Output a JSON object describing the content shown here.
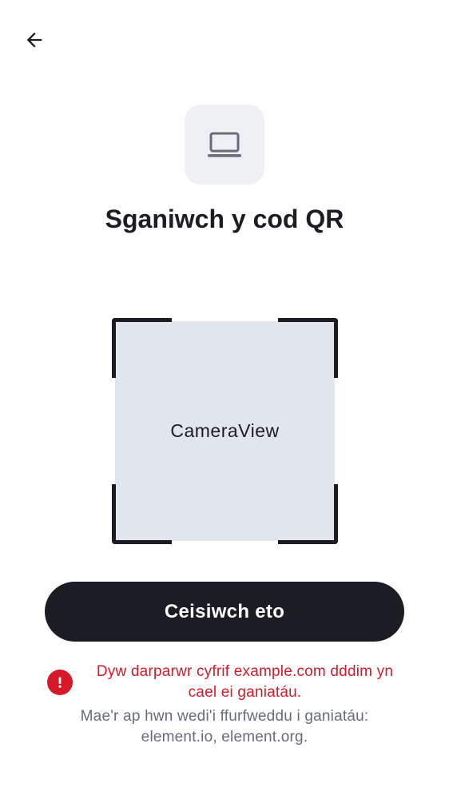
{
  "header": {
    "back_icon": "arrow-left-icon"
  },
  "hero": {
    "icon": "laptop-icon",
    "title": "Sganiwch y cod QR"
  },
  "camera": {
    "placeholder_label": "CameraView"
  },
  "actions": {
    "retry_label": "Ceisiwch eto"
  },
  "error": {
    "icon": "error-icon",
    "message": "Dyw darparwr cyfrif example.com dddim yn cael ei ganiatáu.",
    "help": "Mae'r ap hwn wedi'i ffurfweddu i ganiatáu: element.io, element.org."
  },
  "colors": {
    "error": "#d51928",
    "button_bg": "#1b1d22",
    "camera_bg": "#e1e6ec",
    "icon_tile_bg": "#eef0f4",
    "secondary_text": "#656d77"
  }
}
